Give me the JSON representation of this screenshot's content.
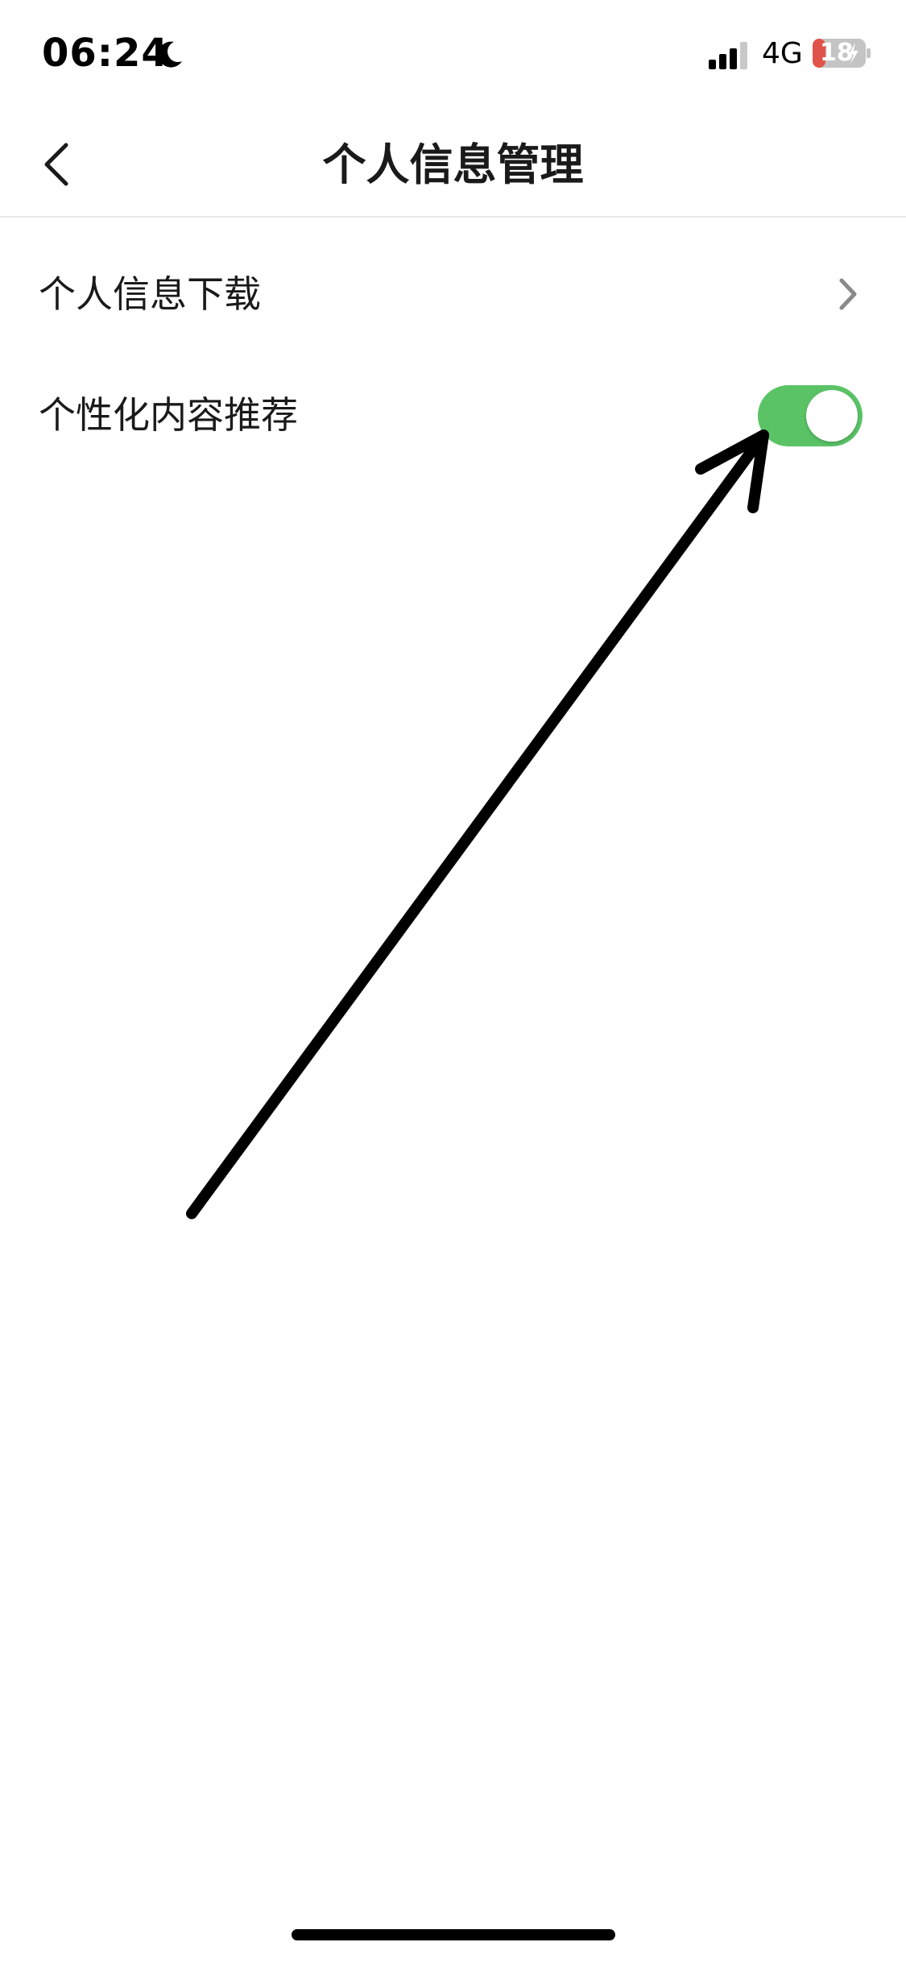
{
  "status_bar": {
    "time": "06:24",
    "network": "4G",
    "battery": "18",
    "icons": [
      "moon-icon",
      "signal-icon",
      "battery-icon"
    ]
  },
  "nav": {
    "title": "个人信息管理",
    "back_icon": "chevron-left-icon"
  },
  "list": {
    "items": [
      {
        "label": "个人信息下载",
        "accessory": "chevron-right-icon"
      },
      {
        "label": "个性化内容推荐",
        "accessory": "toggle",
        "toggle_on": true
      }
    ]
  },
  "colors": {
    "toggle_on": "#5ac366",
    "battery_low": "#e0534a",
    "divider": "#e8e8e8"
  }
}
